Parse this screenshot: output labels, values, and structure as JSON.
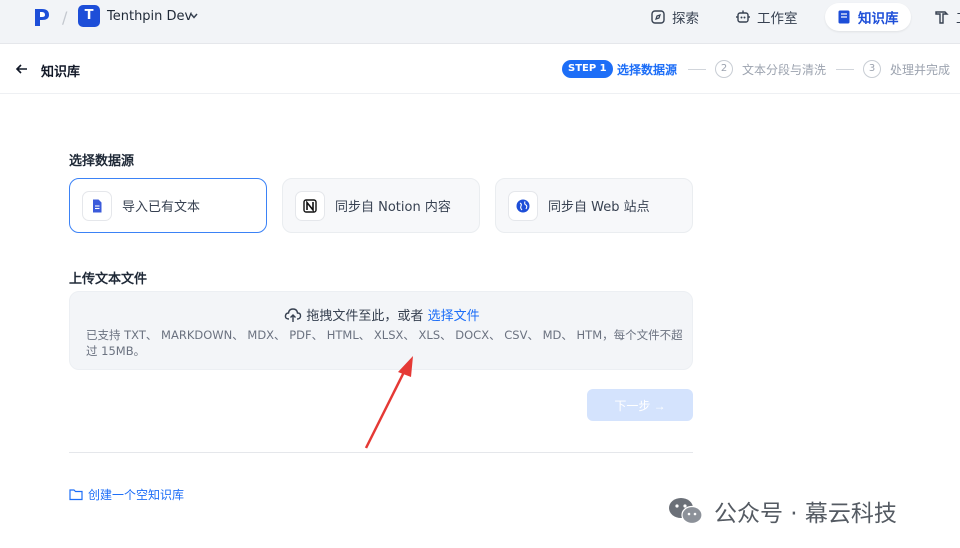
{
  "workspace": {
    "initial": "T",
    "name": "Tenthpin Dev"
  },
  "nav": {
    "explore": "探索",
    "studio": "工作室",
    "knowledge": "知识库",
    "tools_partial": "工"
  },
  "header": {
    "title": "知识库"
  },
  "steps": [
    {
      "badge": "STEP 1",
      "label": "选择数据源",
      "active": true
    },
    {
      "number": "2",
      "label": "文本分段与清洗",
      "active": false
    },
    {
      "number": "3",
      "label": "处理并完成",
      "active": false
    }
  ],
  "source_section": {
    "title": "选择数据源"
  },
  "sources": [
    {
      "label": "导入已有文本",
      "icon": "document-icon",
      "selected": true
    },
    {
      "label": "同步自 Notion 内容",
      "icon": "notion-icon",
      "selected": false
    },
    {
      "label": "同步自 Web 站点",
      "icon": "web-icon",
      "selected": false
    }
  ],
  "upload": {
    "title": "上传文本文件",
    "drag_text": "拖拽文件至此，或者",
    "choose_link": "选择文件",
    "note": "已支持 TXT、 MARKDOWN、 MDX、 PDF、 HTML、 XLSX、 XLS、 DOCX、 CSV、 MD、 HTM，每个文件不超过 15MB。"
  },
  "next_button": "下一步 →",
  "create_empty": "创建一个空知识库",
  "watermark": "公众号 · 幕云科技",
  "colors": {
    "accent": "#1d6ef7",
    "brand": "#1d4ed8",
    "disabled_button": "#d4e3fd",
    "annotation": "#e53935"
  }
}
